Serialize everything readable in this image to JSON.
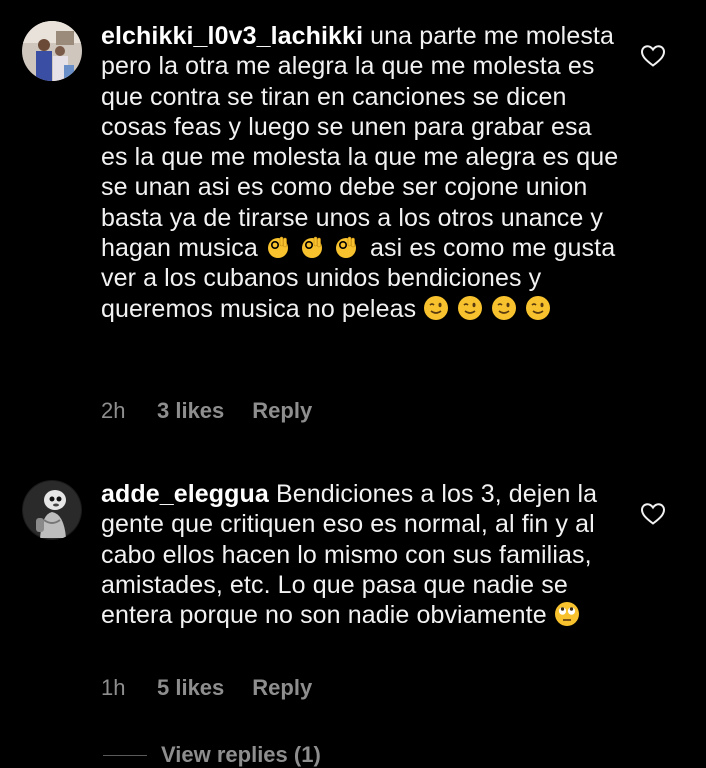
{
  "comments": [
    {
      "username": "elchikki_l0v3_lachikki",
      "text_part1": "una parte me molesta pero la otra me alegra la que me molesta es que contra se tiran en canciones se dicen cosas feas y luego se unen para grabar esa es la que me molesta la que me alegra es que se unan asi es como debe ser cojone union basta ya de tirarse unos a los otros unance y hagan musica",
      "text_part2": "asi es como me gusta ver a los cubanos unidos bendiciones y queremos musica no peleas",
      "emojis_part1": [
        "ok-hand",
        "ok-hand",
        "ok-hand"
      ],
      "emojis_part2": [
        "winking-face",
        "winking-face",
        "winking-face",
        "winking-face"
      ],
      "time": "2h",
      "likes": "3 likes",
      "reply_label": "Reply"
    },
    {
      "username": "adde_eleggua",
      "text_part1": "Bendiciones a los 3, dejen la gente que critiquen eso es normal, al fin y al cabo ellos hacen lo mismo con sus familias, amistades, etc. Lo que pasa que nadie se entera porque no son nadie obviamente",
      "emojis_part1": [
        "face-with-rolling-eyes"
      ],
      "time": "1h",
      "likes": "5 likes",
      "reply_label": "Reply"
    }
  ],
  "view_replies": "View replies (1)",
  "colors": {
    "background": "#000000",
    "text": "#f2f2f2",
    "muted": "#8e8e8e",
    "emoji_yellow": "#f7c22d"
  }
}
